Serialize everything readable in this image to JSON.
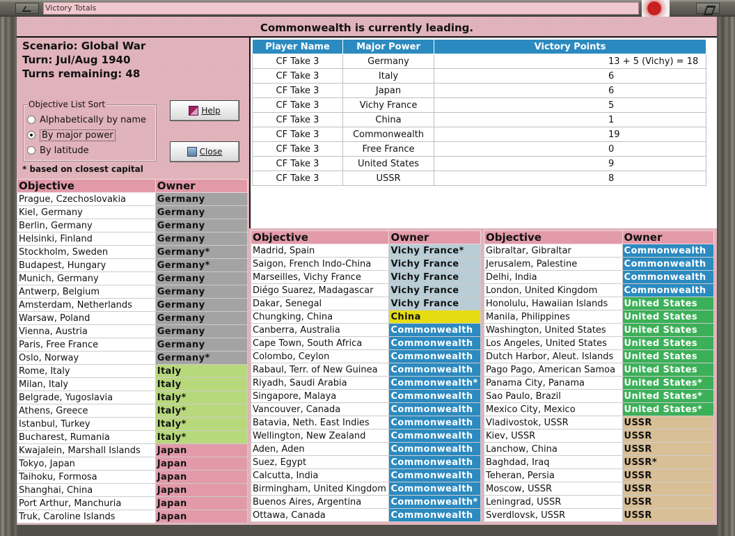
{
  "window": {
    "title": "Victory Totals"
  },
  "header": {
    "leading_text": "Commonwealth is currently leading.",
    "scenario": "Scenario: Global War",
    "turn": "Turn: Jul/Aug 1940",
    "turns_remaining": "Turns remaining: 48"
  },
  "sort": {
    "legend": "Objective List Sort",
    "options": [
      "Alphabetically by name",
      "By major power",
      "By latitude"
    ],
    "selected_index": 1,
    "footnote": "* based on closest capital"
  },
  "buttons": {
    "help": "Help",
    "close": "Close"
  },
  "victory_points": {
    "headers": [
      "Player Name",
      "Major Power",
      "Victory Points"
    ],
    "rows": [
      [
        "CF Take 3",
        "Germany",
        "13  + 5 (Vichy) = 18"
      ],
      [
        "CF Take 3",
        "Italy",
        "6"
      ],
      [
        "CF Take 3",
        "Japan",
        "6"
      ],
      [
        "CF Take 3",
        "Vichy France",
        "5"
      ],
      [
        "CF Take 3",
        "China",
        "1"
      ],
      [
        "CF Take 3",
        "Commonwealth",
        "19"
      ],
      [
        "CF Take 3",
        "Free France",
        "0"
      ],
      [
        "CF Take 3",
        "United States",
        "9"
      ],
      [
        "CF Take 3",
        "USSR",
        "8"
      ]
    ]
  },
  "objective_headers": {
    "objective": "Objective",
    "owner": "Owner"
  },
  "owner_colors": {
    "germany": "#a3a3a3",
    "italy": "#b8d87c",
    "japan": "#e29aa9",
    "vichy": "#b9cdd6",
    "china": "#e6dc12",
    "commonwealth": "#2b8ac0",
    "us": "#3cb058",
    "ussr": "#d8bf96"
  },
  "objectives_col1": [
    {
      "city": "Prague, Czechoslovakia",
      "owner": "Germany",
      "power": "germany"
    },
    {
      "city": "Kiel, Germany",
      "owner": "Germany",
      "power": "germany"
    },
    {
      "city": "Berlin, Germany",
      "owner": "Germany",
      "power": "germany"
    },
    {
      "city": "Helsinki, Finland",
      "owner": "Germany",
      "power": "germany"
    },
    {
      "city": "Stockholm, Sweden",
      "owner": "Germany*",
      "power": "germany"
    },
    {
      "city": "Budapest, Hungary",
      "owner": "Germany*",
      "power": "germany"
    },
    {
      "city": "Munich, Germany",
      "owner": "Germany",
      "power": "germany"
    },
    {
      "city": "Antwerp, Belgium",
      "owner": "Germany",
      "power": "germany"
    },
    {
      "city": "Amsterdam, Netherlands",
      "owner": "Germany",
      "power": "germany"
    },
    {
      "city": "Warsaw, Poland",
      "owner": "Germany",
      "power": "germany"
    },
    {
      "city": "Vienna, Austria",
      "owner": "Germany",
      "power": "germany"
    },
    {
      "city": "Paris, Free France",
      "owner": "Germany",
      "power": "germany"
    },
    {
      "city": "Oslo, Norway",
      "owner": "Germany*",
      "power": "germany"
    },
    {
      "city": "Rome, Italy",
      "owner": "Italy",
      "power": "italy"
    },
    {
      "city": "Milan, Italy",
      "owner": "Italy",
      "power": "italy"
    },
    {
      "city": "Belgrade, Yugoslavia",
      "owner": "Italy*",
      "power": "italy"
    },
    {
      "city": "Athens, Greece",
      "owner": "Italy*",
      "power": "italy"
    },
    {
      "city": "Istanbul, Turkey",
      "owner": "Italy*",
      "power": "italy"
    },
    {
      "city": "Bucharest, Rumania",
      "owner": "Italy*",
      "power": "italy"
    },
    {
      "city": "Kwajalein, Marshall Islands",
      "owner": "Japan",
      "power": "japan"
    },
    {
      "city": "Tokyo, Japan",
      "owner": "Japan",
      "power": "japan"
    },
    {
      "city": "Taihoku, Formosa",
      "owner": "Japan",
      "power": "japan"
    },
    {
      "city": "Shanghai, China",
      "owner": "Japan",
      "power": "japan"
    },
    {
      "city": "Port Arthur, Manchuria",
      "owner": "Japan",
      "power": "japan"
    },
    {
      "city": "Truk, Caroline Islands",
      "owner": "Japan",
      "power": "japan"
    }
  ],
  "objectives_col2": [
    {
      "city": "Madrid, Spain",
      "owner": "Vichy France*",
      "power": "vichy"
    },
    {
      "city": "Saigon, French Indo-China",
      "owner": "Vichy France",
      "power": "vichy"
    },
    {
      "city": "Marseilles, Vichy France",
      "owner": "Vichy France",
      "power": "vichy"
    },
    {
      "city": "Diégo Suarez, Madagascar",
      "owner": "Vichy France",
      "power": "vichy"
    },
    {
      "city": "Dakar, Senegal",
      "owner": "Vichy France",
      "power": "vichy"
    },
    {
      "city": "Chungking, China",
      "owner": "China",
      "power": "china"
    },
    {
      "city": "Canberra, Australia",
      "owner": "Commonwealth",
      "power": "commonwealth"
    },
    {
      "city": "Cape Town, South Africa",
      "owner": "Commonwealth",
      "power": "commonwealth"
    },
    {
      "city": "Colombo, Ceylon",
      "owner": "Commonwealth",
      "power": "commonwealth"
    },
    {
      "city": "Rabaul, Terr. of New Guinea",
      "owner": "Commonwealth",
      "power": "commonwealth"
    },
    {
      "city": "Riyadh, Saudi Arabia",
      "owner": "Commonwealth*",
      "power": "commonwealth"
    },
    {
      "city": "Singapore, Malaya",
      "owner": "Commonwealth",
      "power": "commonwealth"
    },
    {
      "city": "Vancouver, Canada",
      "owner": "Commonwealth",
      "power": "commonwealth"
    },
    {
      "city": "Batavia, Neth. East Indies",
      "owner": "Commonwealth",
      "power": "commonwealth"
    },
    {
      "city": "Wellington, New Zealand",
      "owner": "Commonwealth",
      "power": "commonwealth"
    },
    {
      "city": "Aden, Aden",
      "owner": "Commonwealth",
      "power": "commonwealth"
    },
    {
      "city": "Suez, Egypt",
      "owner": "Commonwealth",
      "power": "commonwealth"
    },
    {
      "city": "Calcutta, India",
      "owner": "Commonwealth",
      "power": "commonwealth"
    },
    {
      "city": "Birmingham, United Kingdom",
      "owner": "Commonwealth",
      "power": "commonwealth"
    },
    {
      "city": "Buenos Aires, Argentina",
      "owner": "Commonwealth*",
      "power": "commonwealth"
    },
    {
      "city": "Ottawa, Canada",
      "owner": "Commonwealth",
      "power": "commonwealth"
    }
  ],
  "objectives_col3": [
    {
      "city": "Gibraltar, Gibraltar",
      "owner": "Commonwealth",
      "power": "commonwealth"
    },
    {
      "city": "Jerusalem, Palestine",
      "owner": "Commonwealth",
      "power": "commonwealth"
    },
    {
      "city": "Delhi, India",
      "owner": "Commonwealth",
      "power": "commonwealth"
    },
    {
      "city": "London, United Kingdom",
      "owner": "Commonwealth",
      "power": "commonwealth"
    },
    {
      "city": "Honolulu, Hawaiian Islands",
      "owner": "United States",
      "power": "us"
    },
    {
      "city": "Manila, Philippines",
      "owner": "United States",
      "power": "us"
    },
    {
      "city": "Washington, United States",
      "owner": "United States",
      "power": "us"
    },
    {
      "city": "Los Angeles, United States",
      "owner": "United States",
      "power": "us"
    },
    {
      "city": "Dutch Harbor, Aleut. Islands",
      "owner": "United States",
      "power": "us"
    },
    {
      "city": "Pago Pago, American Samoa",
      "owner": "United States",
      "power": "us"
    },
    {
      "city": "Panama City, Panama",
      "owner": "United States*",
      "power": "us"
    },
    {
      "city": "Sao Paulo, Brazil",
      "owner": "United States*",
      "power": "us"
    },
    {
      "city": "Mexico City, Mexico",
      "owner": "United States*",
      "power": "us"
    },
    {
      "city": "Vladivostok, USSR",
      "owner": "USSR",
      "power": "ussr"
    },
    {
      "city": "Kiev, USSR",
      "owner": "USSR",
      "power": "ussr"
    },
    {
      "city": "Lanchow, China",
      "owner": "USSR",
      "power": "ussr"
    },
    {
      "city": "Baghdad, Iraq",
      "owner": "USSR*",
      "power": "ussr"
    },
    {
      "city": "Teheran, Persia",
      "owner": "USSR",
      "power": "ussr"
    },
    {
      "city": "Moscow, USSR",
      "owner": "USSR",
      "power": "ussr"
    },
    {
      "city": "Leningrad, USSR",
      "owner": "USSR",
      "power": "ussr"
    },
    {
      "city": "Sverdlovsk, USSR",
      "owner": "USSR",
      "power": "ussr"
    }
  ]
}
